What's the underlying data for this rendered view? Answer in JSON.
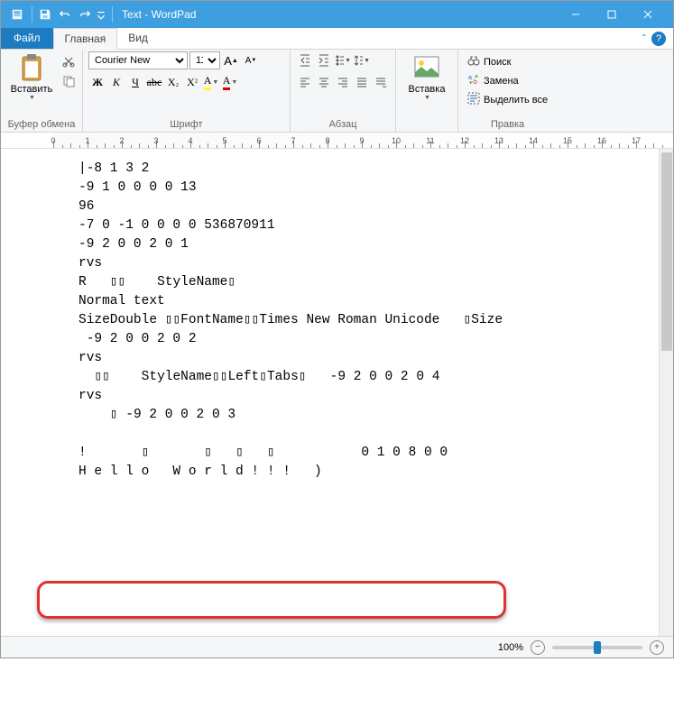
{
  "title": "Text - WordPad",
  "tabs": {
    "file": "Файл",
    "home": "Главная",
    "view": "Вид"
  },
  "groups": {
    "clipboard": {
      "label": "Буфер обмена",
      "paste": "Вставить"
    },
    "font": {
      "label": "Шрифт",
      "name": "Courier New",
      "size": "11"
    },
    "paragraph": {
      "label": "Абзац"
    },
    "insert": {
      "label": "",
      "btn": "Вставка"
    },
    "editing": {
      "label": "Правка",
      "find": "Поиск",
      "replace": "Замена",
      "selectall": "Выделить все"
    }
  },
  "document_lines": [
    "|-8 1 3 2",
    "-9 1 0 0 0 0 13",
    "96",
    "-7 0 -1 0 0 0 0 536870911",
    "-9 2 0 0 2 0 1",
    "rvs",
    "R   ▯▯    StyleName▯",
    "Normal text",
    "SizeDouble ▯▯FontName▯▯Times New Roman Unicode   ▯Size",
    " -9 2 0 0 2 0 2",
    "rvs",
    "  ▯▯    StyleName▯▯Left▯Tabs▯   -9 2 0 0 2 0 4",
    "rvs",
    "    ▯ -9 2 0 0 2 0 3",
    "",
    "!       ▯       ▯   ▯   ▯           0 1 0 8 0 0",
    "H e l l o   W o r l d ! ! !   )"
  ],
  "status": {
    "zoom": "100%"
  }
}
